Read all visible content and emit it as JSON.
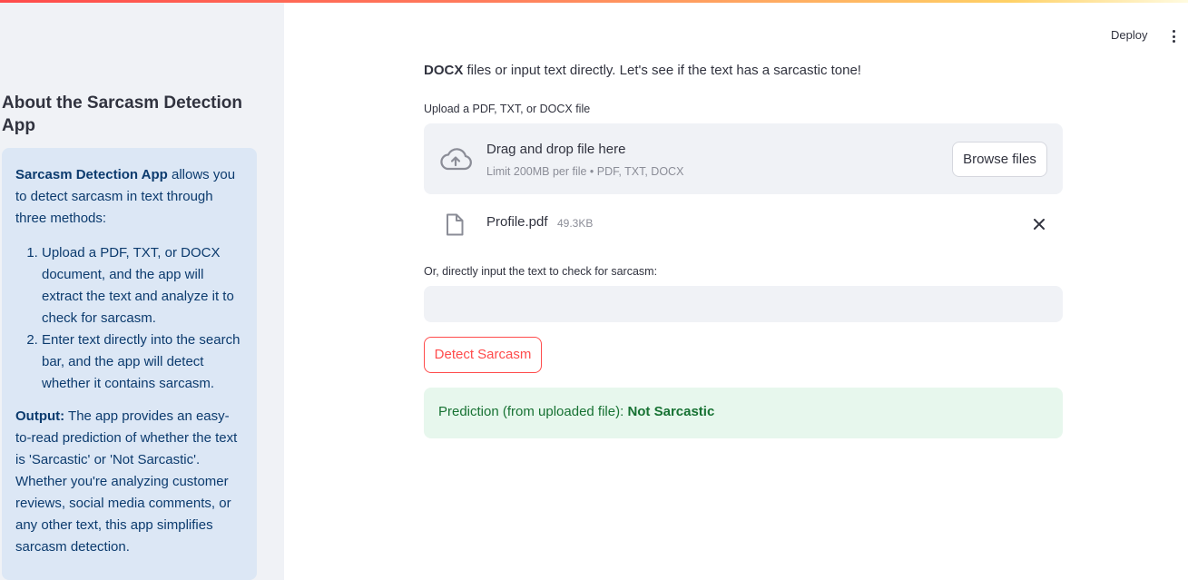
{
  "header": {
    "deploy_label": "Deploy",
    "menu_icon": "kebab-vertical-icon"
  },
  "sidebar": {
    "title": "About the Sarcasm Detection App",
    "info": {
      "app_name": "Sarcasm Detection App",
      "intro_rest": " allows you to detect sarcasm in text through three methods:",
      "methods": [
        "Upload a PDF, TXT, or DOCX document, and the app will extract the text and analyze it to check for sarcasm.",
        "Enter text directly into the search bar, and the app will detect whether it contains sarcasm."
      ],
      "output_label": "Output:",
      "output_text": " The app provides an easy-to-read prediction of whether the text is 'Sarcastic' or 'Not Sarcastic'. Whether you're analyzing customer reviews, social media comments, or any other text, this app simplifies sarcasm detection."
    }
  },
  "main": {
    "intro_bold": "DOCX",
    "intro_rest": " files or input text directly. Let's see if the text has a sarcastic tone!",
    "upload": {
      "label": "Upload a PDF, TXT, or DOCX file",
      "dropzone_title": "Drag and drop file here",
      "dropzone_subtitle": "Limit 200MB per file • PDF, TXT, DOCX",
      "browse_label": "Browse files",
      "file_name": "Profile.pdf",
      "file_size": "49.3KB"
    },
    "text_input": {
      "label": "Or, directly input the text to check for sarcasm:",
      "value": "",
      "placeholder": ""
    },
    "detect_button": "Detect Sarcasm",
    "result": {
      "prefix": "Prediction (from uploaded file): ",
      "value": "Not Sarcastic"
    }
  },
  "colors": {
    "accent": "#ff4b4b",
    "sidebar_bg": "#f0f2f6",
    "info_bg": "#dce7f5",
    "info_text": "#0c3b6e",
    "success_bg": "#e7f7ed",
    "success_text": "#177233"
  }
}
